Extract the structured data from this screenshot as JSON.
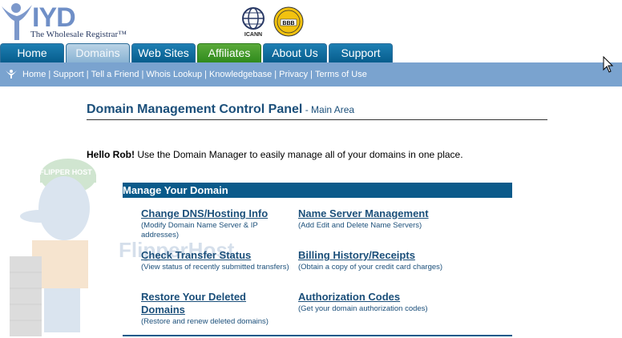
{
  "header": {
    "logo_text": "IYD",
    "logo_tagline": "The Wholesale Registrar",
    "icann_label": "ICANN",
    "bbb_label": "BBB"
  },
  "tabs": [
    {
      "label": "Home"
    },
    {
      "label": "Domains"
    },
    {
      "label": "Web Sites"
    },
    {
      "label": "Affiliates"
    },
    {
      "label": "About Us"
    },
    {
      "label": "Support"
    }
  ],
  "subnav": {
    "links": [
      "Home",
      "Support",
      "Tell a Friend",
      "Whois Lookup",
      "Knowledgebase",
      "Privacy",
      "Terms of Use"
    ]
  },
  "page": {
    "title": "Domain Management Control Panel",
    "title_sub": " - Main Area",
    "hello_name": "Hello Rob!",
    "hello_text": " Use the Domain Manager to easily manage all of your domains in one place."
  },
  "watermark": "FlipperHost",
  "mascot_cap": "FLIPPER HOST",
  "panel": {
    "heading": "Manage Your Domain",
    "items": [
      {
        "label": "Change DNS/Hosting Info",
        "desc": "(Modify Domain Name Server & IP addresses)"
      },
      {
        "label": "Name Server Management",
        "desc": "(Add Edit and Delete Name Servers)"
      },
      {
        "label": "Check Transfer Status",
        "desc": "(View status of recently submitted transfers)"
      },
      {
        "label": "Billing History/Receipts",
        "desc": "(Obtain a copy of your credit card charges)"
      },
      {
        "label": "Restore Your Deleted Domains",
        "desc": "(Restore and renew deleted domains)"
      },
      {
        "label": "Authorization Codes",
        "desc": "(Get your domain authorization codes)"
      }
    ]
  },
  "colors": {
    "tab_blue": "#075d8d",
    "tab_green": "#2f8a1c",
    "subnav": "#7aa3cf",
    "panel": "#0a5a8a",
    "link": "#1b4f7a"
  }
}
